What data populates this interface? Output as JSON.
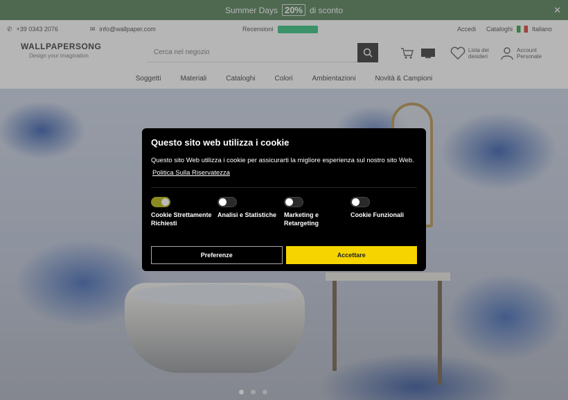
{
  "promo": {
    "text": "Summer Days",
    "badge": "20%",
    "extra": "di sconto",
    "close_icon": "close-icon"
  },
  "contact": {
    "phone": "+39 0343 2076",
    "email": "info@wallpaper.com",
    "review_label": "Recensioni",
    "login": "Accedi",
    "catalog": "Cataloghi",
    "language": "Italiano"
  },
  "logo": {
    "line1": "WALLPAPERSONG",
    "line2": "Design your imagination"
  },
  "search": {
    "placeholder": "Cerca nel negozio"
  },
  "header": {
    "wishlist_label": "Lista dei desideri",
    "account_label": "Account Personale"
  },
  "nav": {
    "items": [
      "Soggetti",
      "Materiali",
      "Cataloghi",
      "Colori",
      "Ambientazioni",
      "Novità & Campioni"
    ]
  },
  "cookie": {
    "title": "Questo sito web utilizza i cookie",
    "description": "Questo sito Web utilizza i cookie per assicurarti la migliore esperienza sul nostro sito Web.",
    "policy_link": "Politica Sulla Riservatezza",
    "toggles": [
      {
        "label": "Cookie Strettamente Richiesti",
        "on": true
      },
      {
        "label": "Analisi e Statistiche",
        "on": false
      },
      {
        "label": "Marketing e Retargeting",
        "on": false
      },
      {
        "label": "Cookie Funzionali",
        "on": false
      }
    ],
    "preferences_button": "Preferenze",
    "accept_button": "Accettare",
    "accent_color": "#f5d400"
  }
}
